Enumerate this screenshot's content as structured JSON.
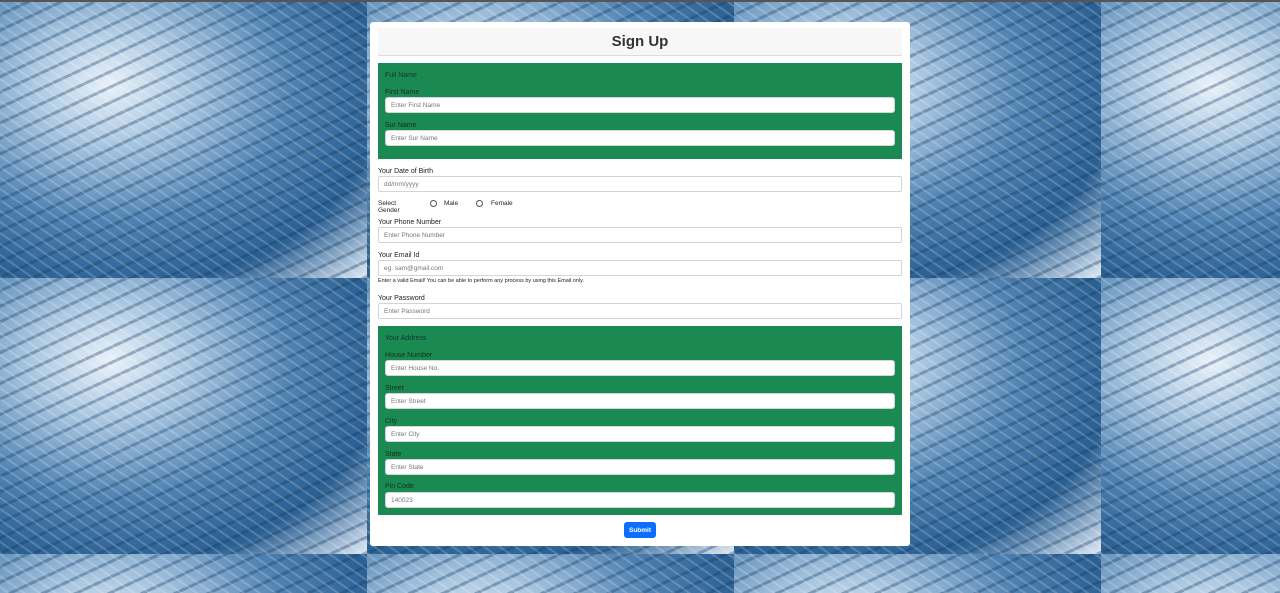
{
  "form": {
    "title": "Sign Up",
    "full_name": {
      "section_label": "Full Name",
      "first_name_label": "First Name",
      "first_name_placeholder": "Enter First Name",
      "sur_name_label": "Sur Name",
      "sur_name_placeholder": "Enter Sur Name"
    },
    "dob": {
      "label": "Your Date of Birth",
      "placeholder": "dd/mm/yyyy"
    },
    "gender": {
      "label": "Select Gender",
      "options": [
        "Male",
        "Female"
      ]
    },
    "phone": {
      "label": "Your Phone Number",
      "placeholder": "Enter Phone Number"
    },
    "email": {
      "label": "Your Email Id",
      "placeholder": "eg. sam@gmail.com",
      "help": "Enter a valid Email! You can be able to perform any process by using this Email only."
    },
    "password": {
      "label": "Your Password",
      "placeholder": "Enter Password"
    },
    "address": {
      "section_label": "Your Address",
      "house_label": "House Number",
      "house_placeholder": "Enter House No.",
      "street_label": "Street",
      "street_placeholder": "Enter Street",
      "city_label": "City",
      "city_placeholder": "Enter City",
      "state_label": "State",
      "state_placeholder": "Enter State",
      "pin_label": "Pin Code",
      "pin_placeholder": "140023"
    },
    "submit_label": "Submit"
  },
  "colors": {
    "section_green": "#1b8a52",
    "submit_blue": "#0d6efd"
  }
}
